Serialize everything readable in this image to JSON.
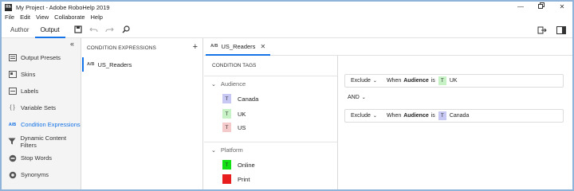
{
  "window": {
    "title": "My Project - Adobe RoboHelp 2019",
    "app_icon": "Rh"
  },
  "menu": [
    "File",
    "Edit",
    "View",
    "Collaborate",
    "Help"
  ],
  "toolbar": {
    "tabs": [
      "Author",
      "Output"
    ],
    "active_tab": "Output"
  },
  "left_nav": {
    "items": [
      {
        "label": "Output Presets",
        "icon": "output-presets-icon"
      },
      {
        "label": "Skins",
        "icon": "skins-icon"
      },
      {
        "label": "Labels",
        "icon": "labels-icon"
      },
      {
        "label": "Variable Sets",
        "icon": "variable-sets-icon"
      },
      {
        "label": "Condition Expressions",
        "icon": "ab-icon",
        "active": true
      },
      {
        "label": "Dynamic Content Filters",
        "icon": "filter-icon"
      },
      {
        "label": "Stop Words",
        "icon": "stop-words-icon"
      },
      {
        "label": "Synonyms",
        "icon": "synonyms-icon"
      }
    ]
  },
  "condition_expressions": {
    "header": "CONDITION EXPRESSIONS",
    "items": [
      {
        "label": "US_Readers",
        "prefix": "A/B"
      }
    ]
  },
  "doc_tab": {
    "prefix": "A/B",
    "label": "US_Readers"
  },
  "condition_tags": {
    "header": "CONDITION TAGS",
    "groups": [
      {
        "name": "Audience",
        "tags": [
          {
            "label": "Canada",
            "letter": "T",
            "color": "#c8c8f5"
          },
          {
            "label": "UK",
            "letter": "T",
            "color": "#c6f2c6"
          },
          {
            "label": "US",
            "letter": "T",
            "color": "#f5caca"
          }
        ]
      },
      {
        "name": "Platform",
        "tags": [
          {
            "label": "Online",
            "letter": "T",
            "color": "#12e012"
          },
          {
            "label": "Print",
            "letter": "",
            "color": "#e81e1e"
          }
        ]
      }
    ]
  },
  "expression": {
    "rules": [
      {
        "op": "Exclude",
        "when": "When",
        "field": "Audience",
        "is": "is",
        "tag_letter": "T",
        "tag_color": "#c6f2c6",
        "value": "UK"
      },
      {
        "op": "Exclude",
        "when": "When",
        "field": "Audience",
        "is": "is",
        "tag_letter": "T",
        "tag_color": "#c8c8f5",
        "value": "Canada"
      }
    ],
    "joiner": "AND"
  },
  "colors": {
    "accent": "#1473e6",
    "border": "#8fb3d9"
  }
}
